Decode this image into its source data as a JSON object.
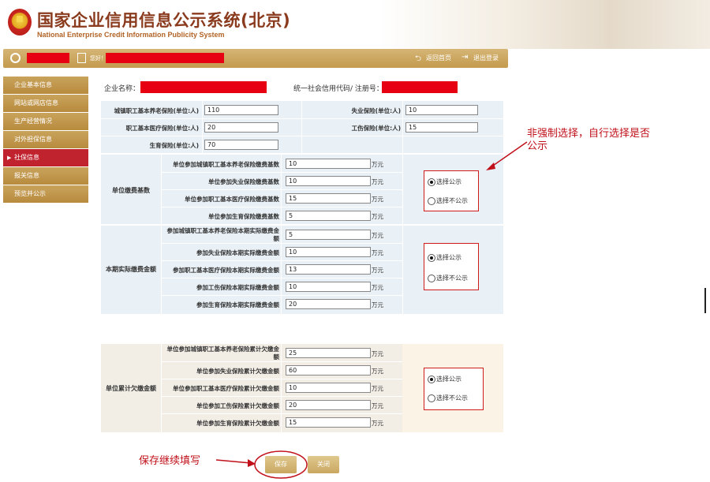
{
  "header": {
    "title": "国家企业信用信息公示系统(北京)",
    "subtitle": "National Enterprise Credit Information Publicity System"
  },
  "topbar": {
    "greeting": "您好！",
    "home_link": "返回首页",
    "logout_link": "退出登录"
  },
  "sidebar": {
    "items": [
      {
        "label": "企业基本信息"
      },
      {
        "label": "网站或网店信息"
      },
      {
        "label": "生产经营情况"
      },
      {
        "label": "对外担保信息"
      },
      {
        "label": "社保信息"
      },
      {
        "label": "报关信息"
      },
      {
        "label": "预览并公示"
      }
    ],
    "active_index": 4
  },
  "company": {
    "name_label": "企业名称：",
    "code_label": "统一社会信用代码/ 注册号："
  },
  "insured": {
    "rows": [
      {
        "left_label": "城镇职工基本养老保险(单位:人)",
        "left_value": "110",
        "right_label": "失业保险(单位:人)",
        "right_value": "10"
      },
      {
        "left_label": "职工基本医疗保险(单位:人)",
        "left_value": "20",
        "right_label": "工伤保险(单位:人)",
        "right_value": "15"
      },
      {
        "left_label": "生育保险(单位:人)",
        "left_value": "70"
      }
    ]
  },
  "payment_base": {
    "group_label": "单位缴费基数",
    "unit": "万元",
    "rows": [
      {
        "label": "单位参加城镇职工基本养老保险缴费基数",
        "value": "10"
      },
      {
        "label": "单位参加失业保险缴费基数",
        "value": "10"
      },
      {
        "label": "单位参加职工基本医疗保险缴费基数",
        "value": "15"
      },
      {
        "label": "单位参加生育保险缴费基数",
        "value": "5"
      }
    ],
    "radio_public": "选择公示",
    "radio_private": "选择不公示"
  },
  "actual_paid": {
    "group_label": "本期实际缴费金额",
    "unit": "万元",
    "rows": [
      {
        "label_line1": "参加城镇职工基本养老保险本期实际缴费金",
        "label_line2": "额",
        "value": "5"
      },
      {
        "label": "参加失业保险本期实际缴费金额",
        "value": "10"
      },
      {
        "label": "参加职工基本医疗保险本期实际缴费金额",
        "value": "13"
      },
      {
        "label": "参加工伤保险本期实际缴费金额",
        "value": "10"
      },
      {
        "label": "参加生育保险本期实际缴费金额",
        "value": "20"
      }
    ],
    "radio_public": "选择公示",
    "radio_private": "选择不公示"
  },
  "arrears": {
    "group_label": "单位累计欠缴金额",
    "unit": "万元",
    "rows": [
      {
        "label_line1": "单位参加城镇职工基本养老保险累计欠缴金",
        "label_line2": "额",
        "value": "25"
      },
      {
        "label": "单位参加失业保险累计欠缴金额",
        "value": "60"
      },
      {
        "label": "单位参加职工基本医疗保险累计欠缴金额",
        "value": "10"
      },
      {
        "label": "单位参加工伤保险累计欠缴金额",
        "value": "20"
      },
      {
        "label": "单位参加生育保险累计欠缴金额",
        "value": "15"
      }
    ],
    "radio_public": "选择公示",
    "radio_private": "选择不公示"
  },
  "annotations": {
    "note_line1": "非强制选择，自行选择是否",
    "note_line2": "公示",
    "save_note": "保存继续填写"
  },
  "buttons": {
    "save": "保存",
    "close": "关闭"
  },
  "colors": {
    "brand_gold": "#c49a4d",
    "active_red": "#c0222e",
    "section_bg": "#eaf1f6",
    "annotation_red": "#c0101a"
  }
}
